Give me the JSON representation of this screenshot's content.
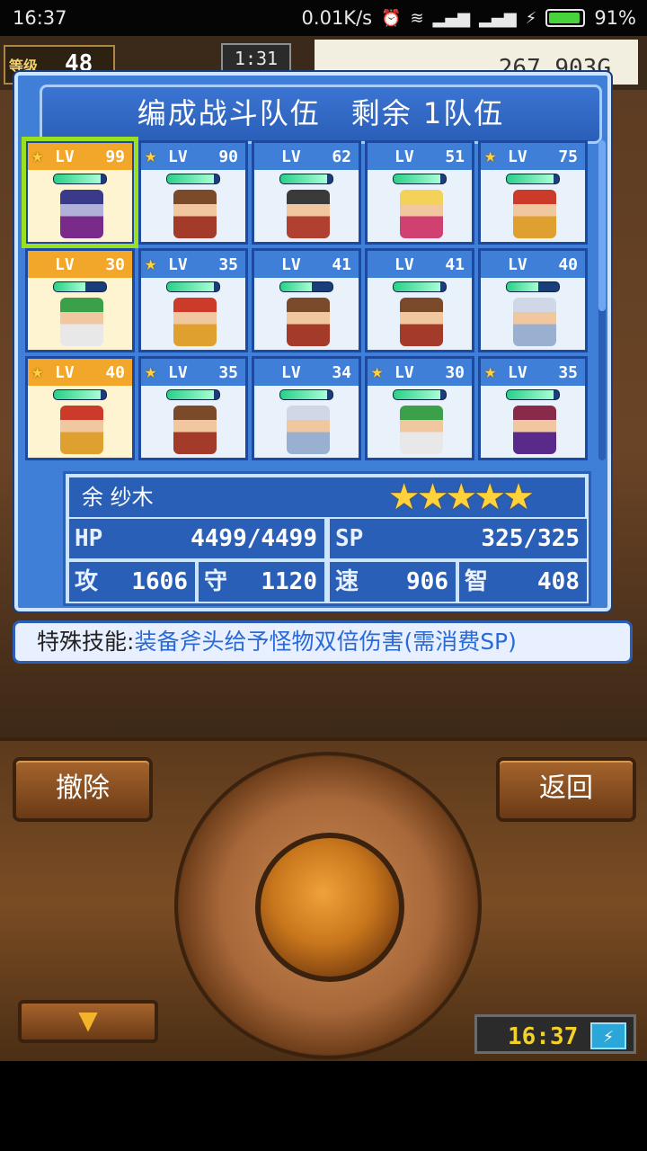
{
  "status_bar": {
    "time": "16:37",
    "net_speed": "0.01K/s",
    "battery": "91%"
  },
  "hud": {
    "level_label": "等级",
    "level": "48",
    "clock": "1:31",
    "money": "267,903G"
  },
  "window": {
    "title": "编成战斗队伍　剩余 1队伍"
  },
  "roster": [
    {
      "lv_label": "LV",
      "level": "99",
      "star": true,
      "gold": true,
      "selected": true,
      "hp": 0.9,
      "sprite": "s1"
    },
    {
      "lv_label": "LV",
      "level": "90",
      "star": true,
      "gold": false,
      "hp": 0.9,
      "sprite": "s0"
    },
    {
      "lv_label": "LV",
      "level": "62",
      "star": false,
      "gold": false,
      "hp": 0.9,
      "sprite": "s2"
    },
    {
      "lv_label": "LV",
      "level": "51",
      "star": false,
      "gold": false,
      "hp": 0.9,
      "sprite": "s3"
    },
    {
      "lv_label": "LV",
      "level": "75",
      "star": true,
      "gold": false,
      "hp": 0.9,
      "sprite": "s4"
    },
    {
      "lv_label": "LV",
      "level": "30",
      "star": false,
      "gold": true,
      "hp": 0.6,
      "sprite": "s5"
    },
    {
      "lv_label": "LV",
      "level": "35",
      "star": true,
      "gold": false,
      "hp": 0.9,
      "sprite": "s4"
    },
    {
      "lv_label": "LV",
      "level": "41",
      "star": false,
      "gold": false,
      "hp": 0.6,
      "sprite": "s0"
    },
    {
      "lv_label": "LV",
      "level": "41",
      "star": false,
      "gold": false,
      "hp": 0.9,
      "sprite": "s0"
    },
    {
      "lv_label": "LV",
      "level": "40",
      "star": false,
      "gold": false,
      "hp": 0.6,
      "sprite": "s6"
    },
    {
      "lv_label": "LV",
      "level": "40",
      "star": true,
      "gold": true,
      "hp": 0.9,
      "sprite": "s4"
    },
    {
      "lv_label": "LV",
      "level": "35",
      "star": true,
      "gold": false,
      "hp": 0.9,
      "sprite": "s0"
    },
    {
      "lv_label": "LV",
      "level": "34",
      "star": false,
      "gold": false,
      "hp": 0.9,
      "sprite": "s6"
    },
    {
      "lv_label": "LV",
      "level": "30",
      "star": true,
      "gold": false,
      "hp": 0.9,
      "sprite": "s5"
    },
    {
      "lv_label": "LV",
      "level": "35",
      "star": true,
      "gold": false,
      "hp": 0.9,
      "sprite": "s7"
    }
  ],
  "selected_character": {
    "name": "余 纱木",
    "stars": "★★★★★",
    "hp_label": "HP",
    "hp": "4499/4499",
    "sp_label": "SP",
    "sp": "325/325",
    "atk_label": "攻",
    "atk": "1606",
    "def_label": "守",
    "def": "1120",
    "spd_label": "速",
    "spd": "906",
    "int_label": "智",
    "int": "408"
  },
  "skill": {
    "label": "特殊技能:",
    "text": "装备斧头给予怪物双倍伤害(需消费SP)"
  },
  "controls": {
    "remove_label": "撤除",
    "back_label": "返回",
    "down_arrow": "▼",
    "clock": "16:37",
    "bolt": "⚡"
  },
  "colors": {
    "panel_blue": "#3f7fd8",
    "selection_green": "#9be020",
    "gold_header": "#f2a62a",
    "skill_text": "#2a6ad8"
  }
}
